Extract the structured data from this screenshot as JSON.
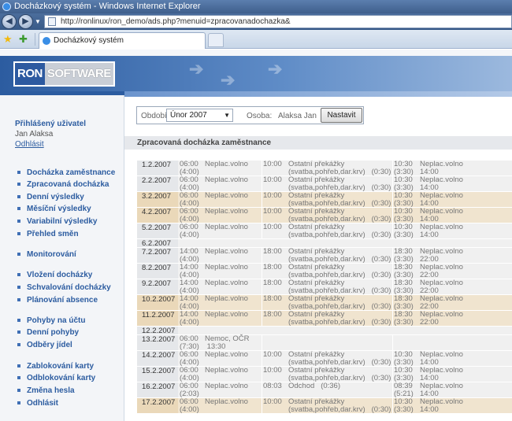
{
  "window": {
    "title": "Docházkový systém - Windows Internet Explorer"
  },
  "addressbar": {
    "url": "http://ronlinux/ron_demo/ads.php?menuid=zpracovanadochazka&"
  },
  "tabs": [
    {
      "label": "Docházkový systém"
    }
  ],
  "logo": {
    "part1": "RON",
    "part2": "SOFTWARE"
  },
  "user": {
    "label": "Přihlášený uživatel",
    "name": "Jan Alaksa",
    "logout": "Odhlásit"
  },
  "menu": [
    "Docházka zaměstnance",
    "Zpracovaná docházka",
    "Denní výsledky",
    "Měsíční výsledky",
    "Variabilní výsledky",
    "Přehled směn",
    "Monitorování",
    "Vložení docházky",
    "Schvalování docházky",
    "Plánování absence",
    "Pohyby na účtu",
    "Denní pohyby",
    "Odběry jídel",
    "Zablokování karty",
    "Odblokování karty",
    "Změna hesla",
    "Odhlásit"
  ],
  "filter": {
    "period_label": "Období:",
    "period_value": "Únor 2007",
    "person_label": "Osoba:",
    "person_value": "Alaksa Jan",
    "submit_label": "Nastavit"
  },
  "section_title": "Zpracovaná docházka zaměstnance",
  "rows": [
    {
      "date": "1.2.2007",
      "hl": false,
      "c1": "06:00\n(4:00)",
      "c2": "Neplac.volno",
      "c3": "10:00",
      "c4": "Ostatní překážky\n(svatba,pohřeb,dar.krv)   (0:30)",
      "c5": "10:30\n(3:30)",
      "c6": "Neplac.volno\n14:00"
    },
    {
      "date": "2.2.2007",
      "hl": false,
      "c1": "06:00\n(4:00)",
      "c2": "Neplac.volno",
      "c3": "10:00",
      "c4": "Ostatní překážky\n(svatba,pohřeb,dar.krv)   (0:30)",
      "c5": "10:30\n(3:30)",
      "c6": "Neplac.volno\n14:00"
    },
    {
      "date": "3.2.2007",
      "hl": true,
      "c1": "06:00\n(4:00)",
      "c2": "Neplac.volno",
      "c3": "10:00",
      "c4": "Ostatní překážky\n(svatba,pohřeb,dar.krv)   (0:30)",
      "c5": "10:30\n(3:30)",
      "c6": "Neplac.volno\n14:00"
    },
    {
      "date": "4.2.2007",
      "hl": true,
      "c1": "06:00\n(4:00)",
      "c2": "Neplac.volno",
      "c3": "10:00",
      "c4": "Ostatní překážky\n(svatba,pohřeb,dar.krv)   (0:30)",
      "c5": "10:30\n(3:30)",
      "c6": "Neplac.volno\n14:00"
    },
    {
      "date": "5.2.2007",
      "hl": false,
      "c1": "06:00\n(4:00)",
      "c2": "Neplac.volno",
      "c3": "10:00",
      "c4": "Ostatní překážky\n(svatba,pohřeb,dar.krv)   (0:30)",
      "c5": "10:30\n(3:30)",
      "c6": "Neplac.volno\n14:00"
    },
    {
      "date": "6.2.2007",
      "hl": false,
      "single": true,
      "c1": "",
      "c2": "",
      "c3": "",
      "c4": "",
      "c5": "",
      "c6": ""
    },
    {
      "date": "7.2.2007",
      "hl": false,
      "c1": "14:00\n(4:00)",
      "c2": "Neplac.volno",
      "c3": "18:00",
      "c4": "Ostatní překážky\n(svatba,pohřeb,dar.krv)   (0:30)",
      "c5": "18:30\n(3:30)",
      "c6": "Neplac.volno\n22:00"
    },
    {
      "date": "8.2.2007",
      "hl": false,
      "c1": "14:00\n(4:00)",
      "c2": "Neplac.volno",
      "c3": "18:00",
      "c4": "Ostatní překážky\n(svatba,pohřeb,dar.krv)   (0:30)",
      "c5": "18:30\n(3:30)",
      "c6": "Neplac.volno\n22:00"
    },
    {
      "date": "9.2.2007",
      "hl": false,
      "c1": "14:00\n(4:00)",
      "c2": "Neplac.volno",
      "c3": "18:00",
      "c4": "Ostatní překážky\n(svatba,pohřeb,dar.krv)   (0:30)",
      "c5": "18:30\n(3:30)",
      "c6": "Neplac.volno\n22:00"
    },
    {
      "date": "10.2.2007",
      "hl": true,
      "c1": "14:00\n(4:00)",
      "c2": "Neplac.volno",
      "c3": "18:00",
      "c4": "Ostatní překážky\n(svatba,pohřeb,dar.krv)   (0:30)",
      "c5": "18:30\n(3:30)",
      "c6": "Neplac.volno\n22:00"
    },
    {
      "date": "11.2.2007",
      "hl": true,
      "c1": "14:00\n(4:00)",
      "c2": "Neplac.volno",
      "c3": "18:00",
      "c4": "Ostatní překážky\n(svatba,pohřeb,dar.krv)   (0:30)",
      "c5": "18:30\n(3:30)",
      "c6": "Neplac.volno\n22:00"
    },
    {
      "date": "12.2.2007",
      "hl": false,
      "single": true,
      "c1": "",
      "c2": "",
      "c3": "",
      "c4": "",
      "c5": "",
      "c6": ""
    },
    {
      "date": "13.2.2007",
      "hl": false,
      "c1": "06:00\n(7:30)",
      "c2": "Nemoc, OČR\n 13:30",
      "c3": "",
      "c4": "",
      "c5": "",
      "c6": ""
    },
    {
      "date": "14.2.2007",
      "hl": false,
      "c1": "06:00\n(4:00)",
      "c2": "Neplac.volno",
      "c3": "10:00",
      "c4": "Ostatní překážky\n(svatba,pohřeb,dar.krv)   (0:30)",
      "c5": "10:30\n(3:30)",
      "c6": "Neplac.volno\n14:00"
    },
    {
      "date": "15.2.2007",
      "hl": false,
      "c1": "06:00\n(4:00)",
      "c2": "Neplac.volno",
      "c3": "10:00",
      "c4": "Ostatní překážky\n(svatba,pohřeb,dar.krv)   (0:30)",
      "c5": "10:30\n(3:30)",
      "c6": "Neplac.volno\n14:00"
    },
    {
      "date": "16.2.2007",
      "hl": false,
      "c1": "06:00\n(2:03)",
      "c2": "Neplac.volno",
      "c3": "08:03",
      "c4": "Odchod   (0:36)",
      "c5": "08:39\n(5:21)",
      "c6": "Neplac.volno\n14:00"
    },
    {
      "date": "17.2.2007",
      "hl": true,
      "c1": "06:00\n(4:00)",
      "c2": "Neplac.volno",
      "c3": "10:00",
      "c4": "Ostatní překážky\n(svatba,pohřeb,dar.krv)   (0:30)",
      "c5": "10:30\n(3:30)",
      "c6": "Neplac.volno\n14:00"
    }
  ]
}
